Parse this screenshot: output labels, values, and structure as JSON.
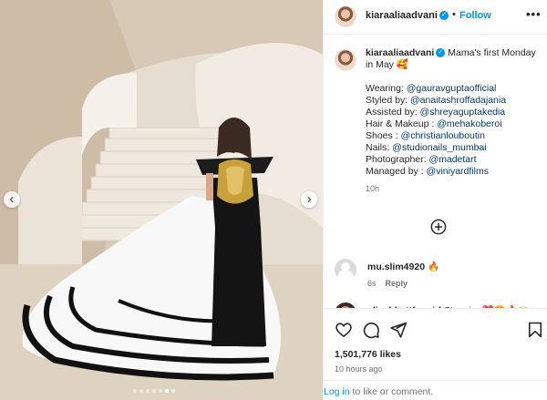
{
  "post": {
    "username": "kiaraaliaadvani",
    "follow_label": "Follow",
    "dot": "•",
    "more": "•••"
  },
  "caption": {
    "username": "kiaraaliaadvani",
    "text": "Mama's first Monday in May 🥰",
    "credits": [
      {
        "label": "Wearing: ",
        "handle": "@gauravguptaofficial"
      },
      {
        "label": "Styled by: ",
        "handle": "@anaitashroffadajania"
      },
      {
        "label": "Assisted by: ",
        "handle": "@shreyaguptakedia"
      },
      {
        "label": "Hair & Makeup : ",
        "handle": "@mehakoberoi"
      },
      {
        "label": "Shoes : ",
        "handle": "@christianlouboutin"
      },
      {
        "label": "Nails: ",
        "handle": "@studionails_mumbai"
      },
      {
        "label": "Photographer: ",
        "handle": "@madetart"
      },
      {
        "label": "Managed by : ",
        "handle": "@viniyardfilms"
      }
    ],
    "time": "10h"
  },
  "comments": [
    {
      "username": "mu.slim4920",
      "text": "🔥",
      "time": "6s",
      "reply": "Reply"
    },
    {
      "username": "aliaabbattfangirl",
      "text": "Stunning❤️😍🔥🙌",
      "time": "",
      "reply": ""
    }
  ],
  "actions": {
    "likes": "1,501,776 likes",
    "ago": "10 hours ago",
    "login_link": "Log in",
    "login_rest": " to like or comment."
  },
  "icons": {
    "verified": "verified-badge-icon",
    "like": "heart-icon",
    "comment": "comment-icon",
    "share": "send-icon",
    "save": "bookmark-icon",
    "load_more": "plus-circle-icon"
  },
  "carousel": {
    "count": 7,
    "active_index": 5
  },
  "colors": {
    "accent": "#0095f6",
    "link": "#00376b",
    "muted": "#737373"
  }
}
